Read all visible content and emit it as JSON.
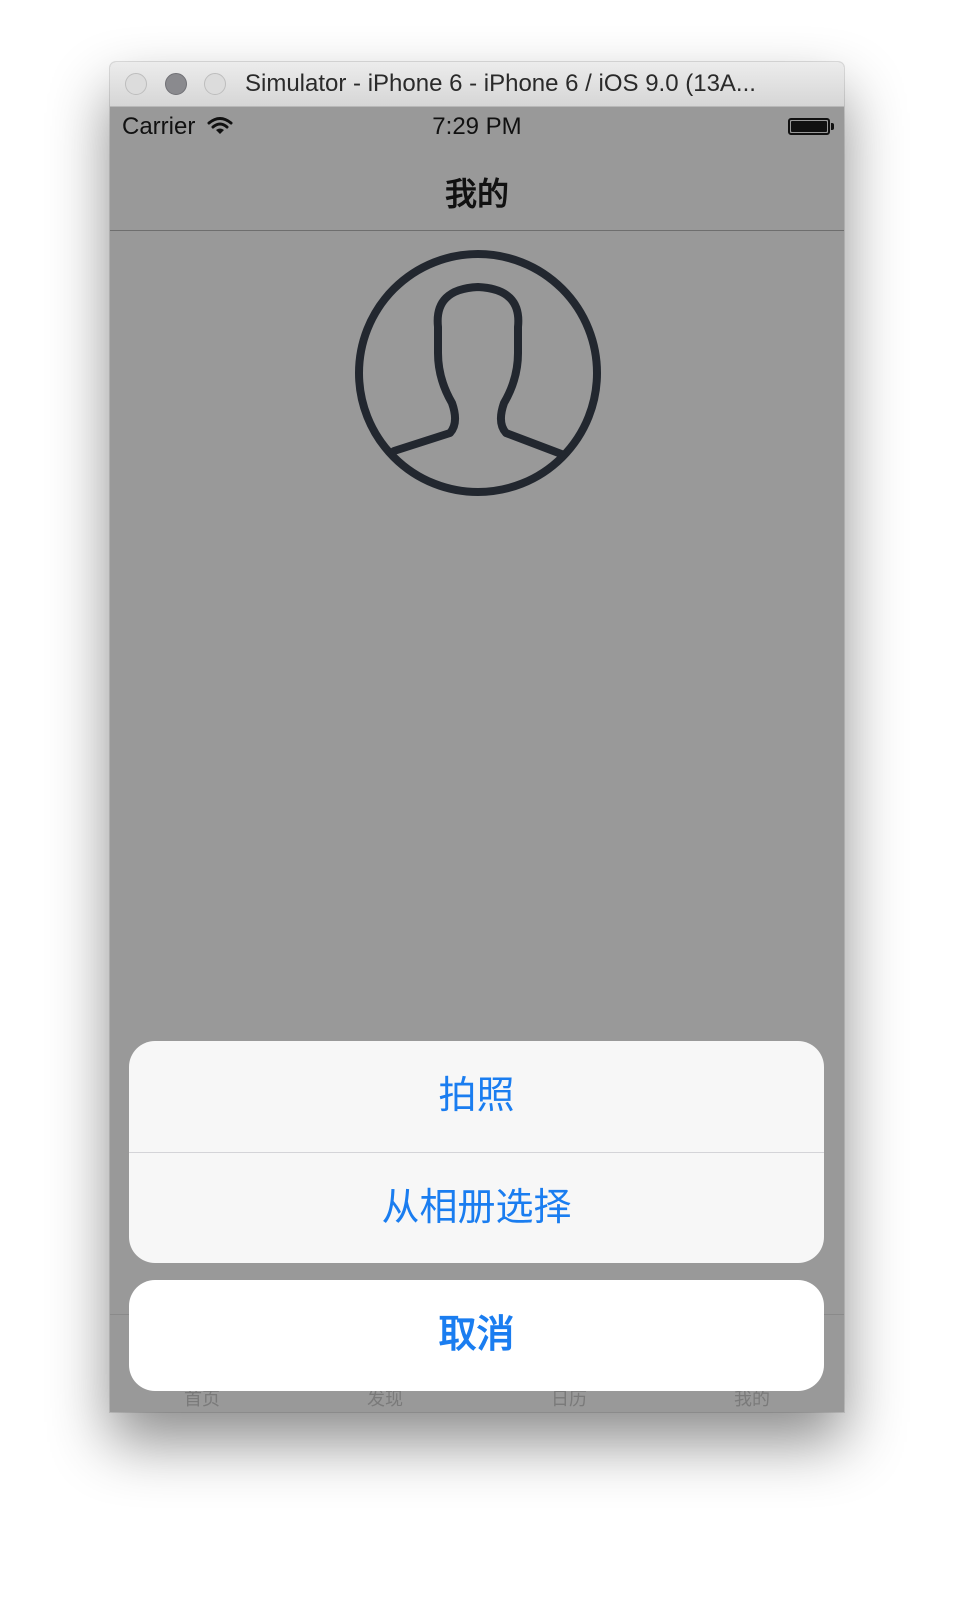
{
  "window": {
    "title": "Simulator - iPhone 6 - iPhone 6 / iOS 9.0 (13A..."
  },
  "statusbar": {
    "carrier": "Carrier",
    "time": "7:29 PM"
  },
  "navbar": {
    "title": "我的"
  },
  "profile": {
    "avatar_icon": "user-avatar-icon"
  },
  "tabbar": {
    "items": [
      {
        "label": "首页"
      },
      {
        "label": "发现"
      },
      {
        "label": "日历"
      },
      {
        "label": "我的"
      }
    ]
  },
  "action_sheet": {
    "options": [
      {
        "label": "拍照"
      },
      {
        "label": "从相册选择"
      }
    ],
    "cancel_label": "取消"
  },
  "colors": {
    "action_text": "#1a7df0",
    "dim_overlay": "#999999",
    "sheet_background": "#f7f7f7"
  }
}
